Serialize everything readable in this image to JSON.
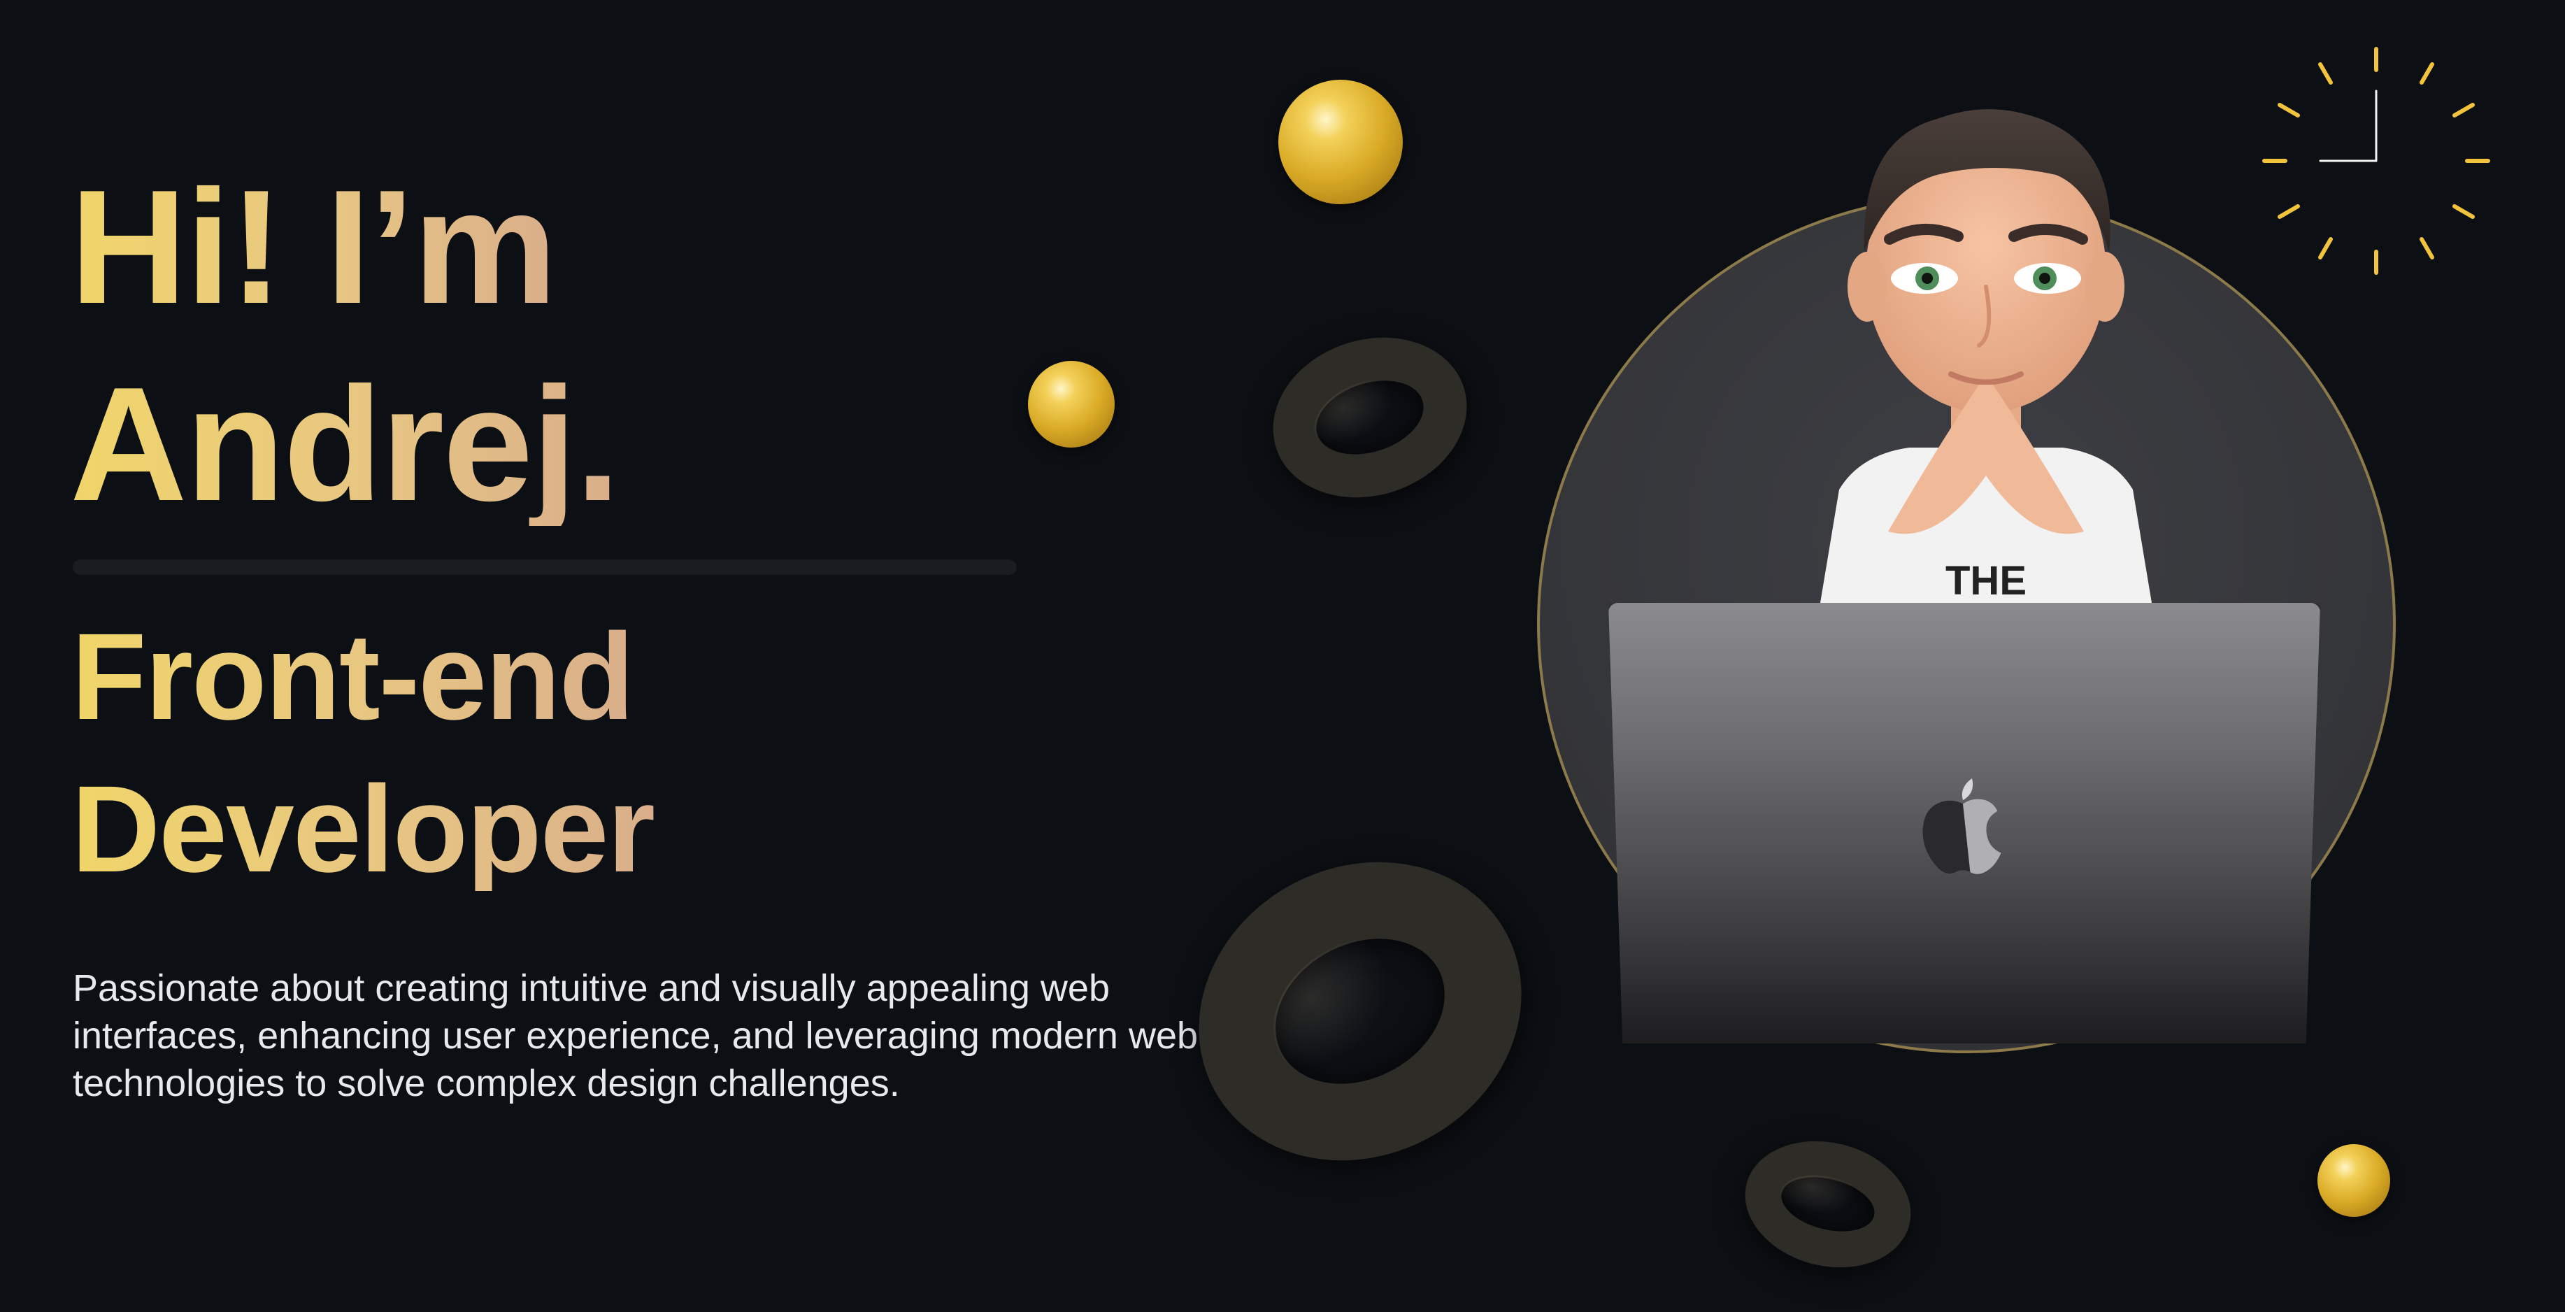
{
  "hero": {
    "greeting_line1": "Hi! I’m",
    "greeting_line2": "Andrej.",
    "role_line1": "Front-end",
    "role_line2": "Developer",
    "bio": "Passionate about creating intuitive and visually appealing web interfaces, enhancing user experience, and leveraging modern web technologies to solve complex design challenges."
  },
  "avatar": {
    "shirt_text": "THE",
    "laptop_logo": "apple-icon"
  },
  "decor": {
    "icons": [
      "clock-icon",
      "gold-ball",
      "dark-torus"
    ]
  },
  "colors": {
    "background": "#0c0f14",
    "accent_gold": "#f0d56a",
    "accent_peach": "#d9ae8a",
    "ball_gold": "#d9aa25",
    "clock_line": "#f2c33b"
  }
}
